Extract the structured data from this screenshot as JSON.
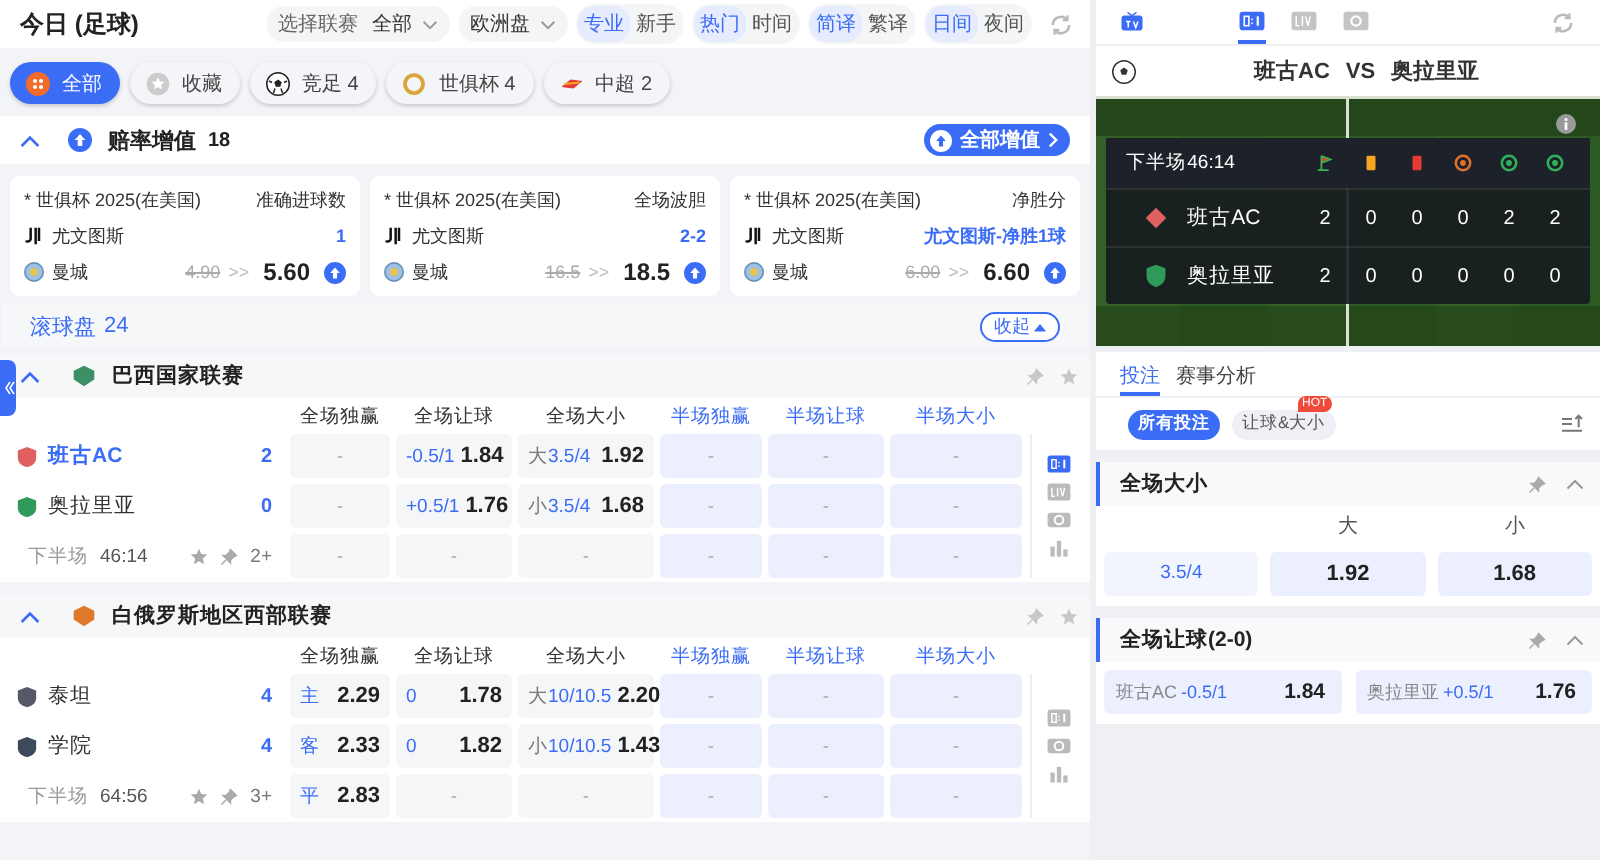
{
  "header": {
    "title": "今日 (足球)",
    "league_select": {
      "label": "选择联赛",
      "value": "全部"
    },
    "odds_select": {
      "value": "欧洲盘"
    },
    "toggles": [
      {
        "options": [
          {
            "label": "专业",
            "selected": true
          },
          {
            "label": "新手",
            "selected": false
          }
        ]
      },
      {
        "options": [
          {
            "label": "热门",
            "selected": true
          },
          {
            "label": "时间",
            "selected": false
          }
        ]
      },
      {
        "options": [
          {
            "label": "简译",
            "selected": true
          },
          {
            "label": "繁译",
            "selected": false
          }
        ]
      },
      {
        "options": [
          {
            "label": "日间",
            "selected": true
          },
          {
            "label": "夜间",
            "selected": false
          }
        ]
      }
    ]
  },
  "filters": [
    {
      "kind": "all",
      "label": "全部",
      "selected": true
    },
    {
      "kind": "favorite",
      "label": "收藏",
      "selected": false
    },
    {
      "kind": "ball",
      "label": "竞足 4",
      "selected": false
    },
    {
      "kind": "cup",
      "label": "世俱杯 4",
      "selected": false
    },
    {
      "kind": "league",
      "label": "中超 2",
      "selected": false
    }
  ],
  "boost": {
    "title": "赔率增值",
    "count": "18",
    "expanded": true,
    "button": "全部增值",
    "cards": [
      {
        "league": "* 世俱杯 2025(在美国)",
        "market": "准确进球数",
        "home": "尤文图斯",
        "pick": "1",
        "away": "曼城",
        "old_odds": "4.90",
        "arrows": ">>",
        "new_odds": "5.60"
      },
      {
        "league": "* 世俱杯 2025(在美国)",
        "market": "全场波胆",
        "home": "尤文图斯",
        "pick": "2-2",
        "away": "曼城",
        "old_odds": "16.5",
        "arrows": ">>",
        "new_odds": "18.5"
      },
      {
        "league": "* 世俱杯 2025(在美国)",
        "market": "净胜分",
        "home": "尤文图斯",
        "pick": "尤文图斯-净胜1球",
        "away": "曼城",
        "old_odds": "6.00",
        "arrows": ">>",
        "new_odds": "6.60"
      }
    ]
  },
  "live": {
    "title": "滚球盘",
    "count": "24",
    "button": "收起"
  },
  "leagues": [
    {
      "name": "巴西国家联赛",
      "color": "#3f8f66",
      "expanded": true,
      "columns": [
        {
          "label": "全场独赢",
          "kind": "full"
        },
        {
          "label": "全场让球",
          "kind": "full"
        },
        {
          "label": "全场大小",
          "kind": "full"
        },
        {
          "label": "半场独赢",
          "kind": "half"
        },
        {
          "label": "半场让球",
          "kind": "half"
        },
        {
          "label": "半场大小",
          "kind": "half"
        }
      ],
      "matches": [
        {
          "teams": [
            {
              "name": "班古AC",
              "score": "2",
              "highlighted": true,
              "color": "#e06060"
            },
            {
              "name": "奥拉里亚",
              "score": "0",
              "highlighted": false,
              "color": "#2f9a5a"
            }
          ],
          "period": "下半场",
          "clock": "46:14",
          "more": "2+",
          "odds": [
            [
              {
                "text": "-"
              },
              {
                "line": "-0.5/1",
                "odds": "1.84"
              },
              {
                "prefix": "大",
                "line": "3.5/4",
                "odds": "1.92"
              },
              {
                "text": "-"
              },
              {
                "text": "-"
              },
              {
                "text": "-"
              }
            ],
            [
              {
                "text": "-"
              },
              {
                "line": "+0.5/1",
                "odds": "1.76"
              },
              {
                "prefix": "小",
                "line": "3.5/4",
                "odds": "1.68"
              },
              {
                "text": "-"
              },
              {
                "text": "-"
              },
              {
                "text": "-"
              }
            ],
            [
              {
                "text": "-"
              },
              {
                "text": "-"
              },
              {
                "text": "-"
              },
              {
                "text": "-"
              },
              {
                "text": "-"
              },
              {
                "text": "-"
              }
            ]
          ],
          "side_icons": [
            {
              "kind": "score",
              "selected": true
            },
            {
              "kind": "live",
              "selected": false
            },
            {
              "kind": "camera",
              "selected": false
            },
            {
              "kind": "stats",
              "selected": false
            }
          ]
        }
      ]
    },
    {
      "name": "白俄罗斯地区西部联赛",
      "color": "#e07a2a",
      "expanded": true,
      "columns": [
        {
          "label": "全场独赢",
          "kind": "full"
        },
        {
          "label": "全场让球",
          "kind": "full"
        },
        {
          "label": "全场大小",
          "kind": "full"
        },
        {
          "label": "半场独赢",
          "kind": "half"
        },
        {
          "label": "半场让球",
          "kind": "half"
        },
        {
          "label": "半场大小",
          "kind": "half"
        }
      ],
      "matches": [
        {
          "teams": [
            {
              "name": "泰坦",
              "score": "4",
              "highlighted": false,
              "color": "#555a66"
            },
            {
              "name": "学院",
              "score": "4",
              "highlighted": false,
              "color": "#3d4a5c"
            }
          ],
          "period": "下半场",
          "clock": "64:56",
          "more": "3+",
          "odds": [
            [
              {
                "line": "主",
                "odds": "2.29"
              },
              {
                "line": "0",
                "odds": "1.78"
              },
              {
                "prefix": "大",
                "line": "10/10.5",
                "odds": "2.20"
              },
              {
                "text": "-"
              },
              {
                "text": "-"
              },
              {
                "text": "-"
              }
            ],
            [
              {
                "line": "客",
                "odds": "2.33"
              },
              {
                "line": "0",
                "odds": "1.82"
              },
              {
                "prefix": "小",
                "line": "10/10.5",
                "odds": "1.43"
              },
              {
                "text": "-"
              },
              {
                "text": "-"
              },
              {
                "text": "-"
              }
            ],
            [
              {
                "line": "平",
                "odds": "2.83"
              },
              {
                "text": "-"
              },
              {
                "text": "-"
              },
              {
                "text": "-"
              },
              {
                "text": "-"
              },
              {
                "text": "-"
              }
            ]
          ],
          "side_icons": [
            {
              "kind": "score",
              "selected": false
            },
            {
              "kind": "camera",
              "selected": false
            },
            {
              "kind": "stats",
              "selected": false
            }
          ]
        }
      ]
    }
  ],
  "detail": {
    "media_tabs": [
      {
        "kind": "score",
        "selected": true
      },
      {
        "kind": "live",
        "selected": false
      },
      {
        "kind": "camera",
        "selected": false
      }
    ],
    "title": {
      "home": "班古AC",
      "vs": "VS",
      "away": "奥拉里亚"
    },
    "scoreboard": {
      "period": "下半场",
      "clock": "46:14",
      "teams": [
        {
          "name": "班古AC",
          "color": "#e06060",
          "stats": [
            "2",
            "0",
            "0",
            "0",
            "2",
            "2"
          ]
        },
        {
          "name": "奥拉里亚",
          "color": "#2f9a5a",
          "stats": [
            "2",
            "0",
            "0",
            "0",
            "0",
            "0"
          ]
        }
      ]
    },
    "tabs": [
      {
        "label": "投注",
        "selected": true
      },
      {
        "label": "赛事分析",
        "selected": false
      }
    ],
    "chips": [
      {
        "label": "所有投注",
        "selected": true
      },
      {
        "label": "让球&大小",
        "selected": false,
        "badge": "HOT"
      }
    ],
    "markets": [
      {
        "kind": "total",
        "title": "全场大小",
        "expanded": true,
        "headers": [
          "大",
          "小"
        ],
        "line": "3.5/4",
        "odds": [
          "1.92",
          "1.68"
        ]
      },
      {
        "kind": "handicap",
        "title": "全场让球(2-0)",
        "expanded": true,
        "options": [
          {
            "team": "班古AC",
            "line": "-0.5/1",
            "odds": "1.84"
          },
          {
            "team": "奥拉里亚",
            "line": "+0.5/1",
            "odds": "1.76"
          }
        ]
      }
    ]
  }
}
